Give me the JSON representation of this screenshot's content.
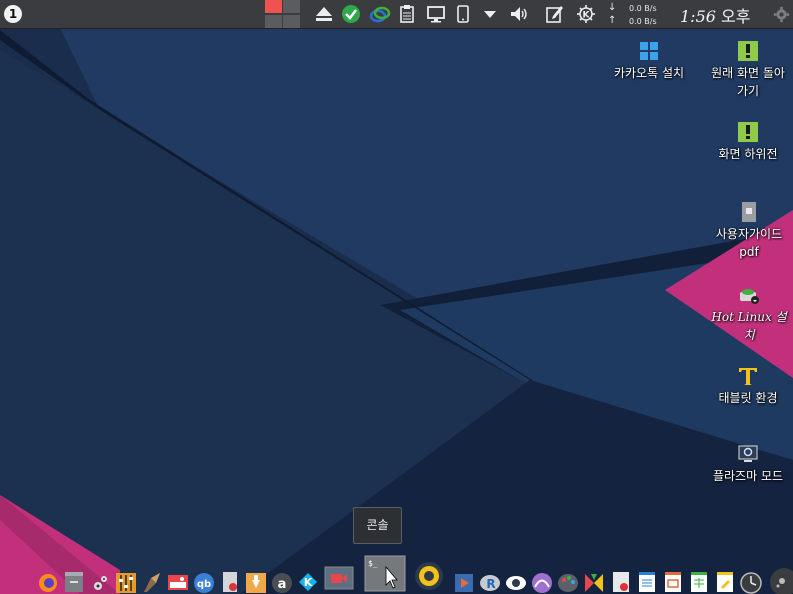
{
  "top_panel": {
    "workspace_number": "1",
    "network": {
      "down_arrow": "↓",
      "up_arrow": "↑",
      "download_rate": "0.0 B/s",
      "upload_rate": "0.0 B/s"
    },
    "clock": {
      "time": "1:56",
      "ampm": "오후"
    }
  },
  "desktop_icons": [
    {
      "label": "카카오톡 설치"
    },
    {
      "label": "원래 화면 돌아가기"
    },
    {
      "label": "화면 하위전"
    },
    {
      "label": "사용자가이드 pdf"
    },
    {
      "label": "Hot Linux 설치"
    },
    {
      "label": "태블릿 환경"
    },
    {
      "label": "플라즈마 모드"
    }
  ],
  "tooltip": {
    "text": "콘솔"
  },
  "colors": {
    "panel": "#3a3c3f",
    "accent_pink": "#c2307c",
    "wall_dark": "#14213a",
    "wall_mid": "#1e3458"
  }
}
